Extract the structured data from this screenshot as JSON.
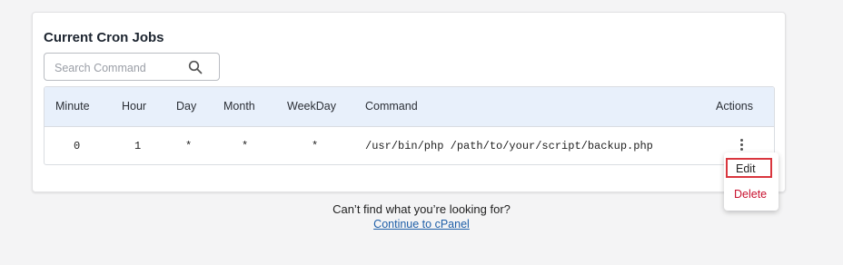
{
  "section": {
    "title": "Current Cron Jobs"
  },
  "search": {
    "placeholder": "Search Command",
    "value": ""
  },
  "table": {
    "columns": [
      "Minute",
      "Hour",
      "Day",
      "Month",
      "WeekDay",
      "Command",
      "Actions"
    ],
    "rows": [
      {
        "minute": "0",
        "hour": "1",
        "day": "*",
        "month": "*",
        "weekday": "*",
        "command": "/usr/bin/php /path/to/your/script/backup.php"
      }
    ]
  },
  "actions_menu": {
    "edit": "Edit",
    "delete": "Delete"
  },
  "footer": {
    "question": "Can’t find what you’re looking for?",
    "link": "Continue to cPanel"
  },
  "colors": {
    "header_bg": "#e8f0fb",
    "delete": "#c8102e",
    "highlight": "#d9363e",
    "link": "#1f5fa8"
  }
}
